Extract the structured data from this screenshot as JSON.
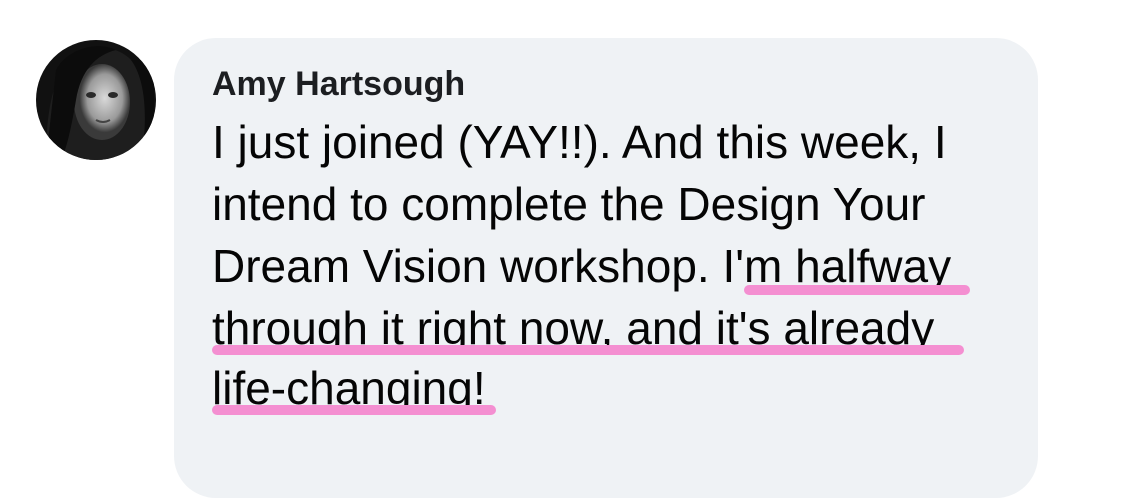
{
  "comment": {
    "author": "Amy Hartsough",
    "lines": [
      {
        "plain": "I just joined (YAY!!). And this week, I",
        "highlight": ""
      },
      {
        "plain": "intend to complete the Design Your",
        "highlight": ""
      },
      {
        "plain": "Dream Vision workshop. ",
        "highlight": "I'm halfway"
      },
      {
        "plain": "",
        "highlight": "through it right now, and it's already"
      },
      {
        "plain": "",
        "highlight": "life-changing",
        "tail": "!"
      }
    ]
  },
  "colors": {
    "bubble": "#eff2f5",
    "highlight": "#f48fd1",
    "text": "#050505"
  },
  "icons": {
    "avatar": "profile-photo"
  }
}
